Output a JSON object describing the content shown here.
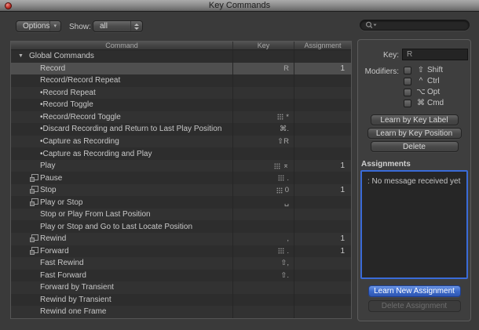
{
  "window": {
    "title": "Key Commands"
  },
  "toolbar": {
    "options_label": "Options",
    "show_label": "Show:",
    "show_value": "all",
    "search_value": ""
  },
  "icons": {
    "options_arrow": "▾",
    "disclosure": "▼"
  },
  "table": {
    "columns": [
      "Command",
      "Key",
      "Assignment"
    ],
    "rows": [
      {
        "type": "group",
        "label": "Global Commands"
      },
      {
        "label": "Record",
        "key": "R",
        "assignment": "1",
        "selected": true
      },
      {
        "label": "Record/Record Repeat"
      },
      {
        "label": "•Record Repeat"
      },
      {
        "label": "•Record Toggle"
      },
      {
        "label": "•Record/Record Toggle",
        "keypad": true,
        "key": "*"
      },
      {
        "label": "•Discard Recording and Return to Last Play Position",
        "key": "⌘."
      },
      {
        "label": "•Capture as Recording",
        "key": "⇧R"
      },
      {
        "label": "•Capture as Recording and Play"
      },
      {
        "label": "Play",
        "keypad": true,
        "key": "⌅",
        "assignment": "1"
      },
      {
        "label": "Pause",
        "controller_icon": true,
        "keypad": true,
        "key": "."
      },
      {
        "label": "Stop",
        "controller_icon": true,
        "keypad": true,
        "key": "0",
        "assignment": "1"
      },
      {
        "label": "Play or Stop",
        "controller_icon": true,
        "key": "␣"
      },
      {
        "label": "Stop or Play From Last Position"
      },
      {
        "label": "Play or Stop and Go to Last Locate Position"
      },
      {
        "label": "Rewind",
        "controller_icon": true,
        "key": ",",
        "assignment": "1"
      },
      {
        "label": "Forward",
        "controller_icon": true,
        "keypad": true,
        "key": ".",
        "assignment": "1"
      },
      {
        "label": "Fast Rewind",
        "key": "⇧,"
      },
      {
        "label": "Fast Forward",
        "key": "⇧."
      },
      {
        "label": "Forward by Transient"
      },
      {
        "label": "Rewind by Transient"
      },
      {
        "label": "Rewind one Frame"
      }
    ]
  },
  "inspector": {
    "key_label": "Key:",
    "key_value": "R",
    "modifiers_label": "Modifiers:",
    "modifiers": [
      {
        "symbol": "⇧",
        "label": "Shift",
        "checked": false
      },
      {
        "symbol": "^",
        "label": "Ctrl",
        "checked": false
      },
      {
        "symbol": "⌥",
        "label": "Opt",
        "checked": false
      },
      {
        "symbol": "⌘",
        "label": "Cmd",
        "checked": false
      }
    ],
    "buttons": [
      "Learn by Key Label",
      "Learn by Key Position",
      "Delete"
    ],
    "assignments_label": "Assignments",
    "assignments_message": ": No message received yet",
    "learn_new_button": "Learn New Assignment",
    "delete_assignment_button": "Delete Assignment",
    "accent_color": "#3a6bd8"
  }
}
